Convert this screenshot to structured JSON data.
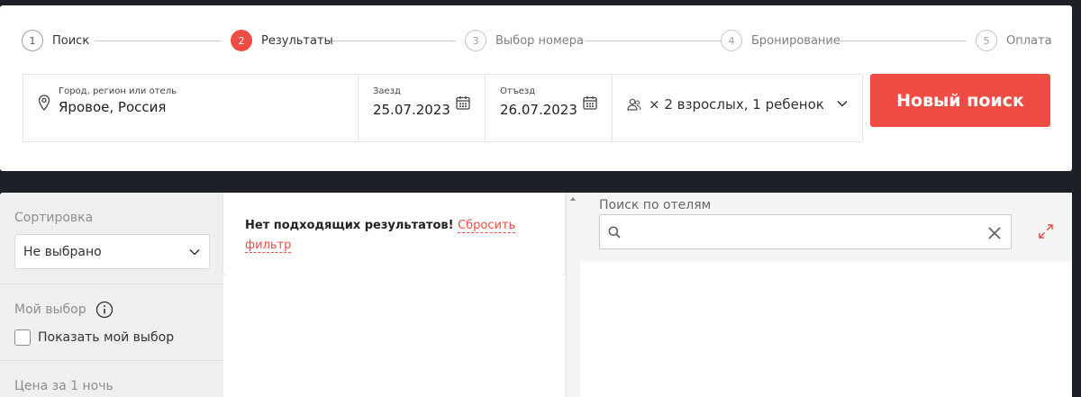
{
  "steps": [
    {
      "number": "1",
      "label": "Поиск"
    },
    {
      "number": "2",
      "label": "Результаты"
    },
    {
      "number": "3",
      "label": "Выбор номера"
    },
    {
      "number": "4",
      "label": "Бронирование"
    },
    {
      "number": "5",
      "label": "Оплата"
    }
  ],
  "active_step": 2,
  "search": {
    "city_label": "Город, регион или отель",
    "city_value": "Яровое, Россия",
    "checkin_label": "Заезд",
    "checkin_value": "25.07.2023",
    "checkout_label": "Отъезд",
    "checkout_value": "26.07.2023",
    "guests_value": "× 2 взрослых, 1 ребенок",
    "new_search_label": "Новый поиск"
  },
  "sidebar": {
    "sort_title": "Сортировка",
    "sort_value": "Не выбрано",
    "my_choice_title": "Мой выбор",
    "show_my_choice_label": "Показать мой выбор",
    "price_title": "Цена за 1 ночь"
  },
  "results": {
    "empty_message": "Нет подходящих результатов!",
    "reset_link": "Сбросить фильтр"
  },
  "map": {
    "search_label": "Поиск по отелям",
    "search_value": ""
  },
  "colors": {
    "accent": "#ef4d44",
    "background": "#1c2027"
  }
}
